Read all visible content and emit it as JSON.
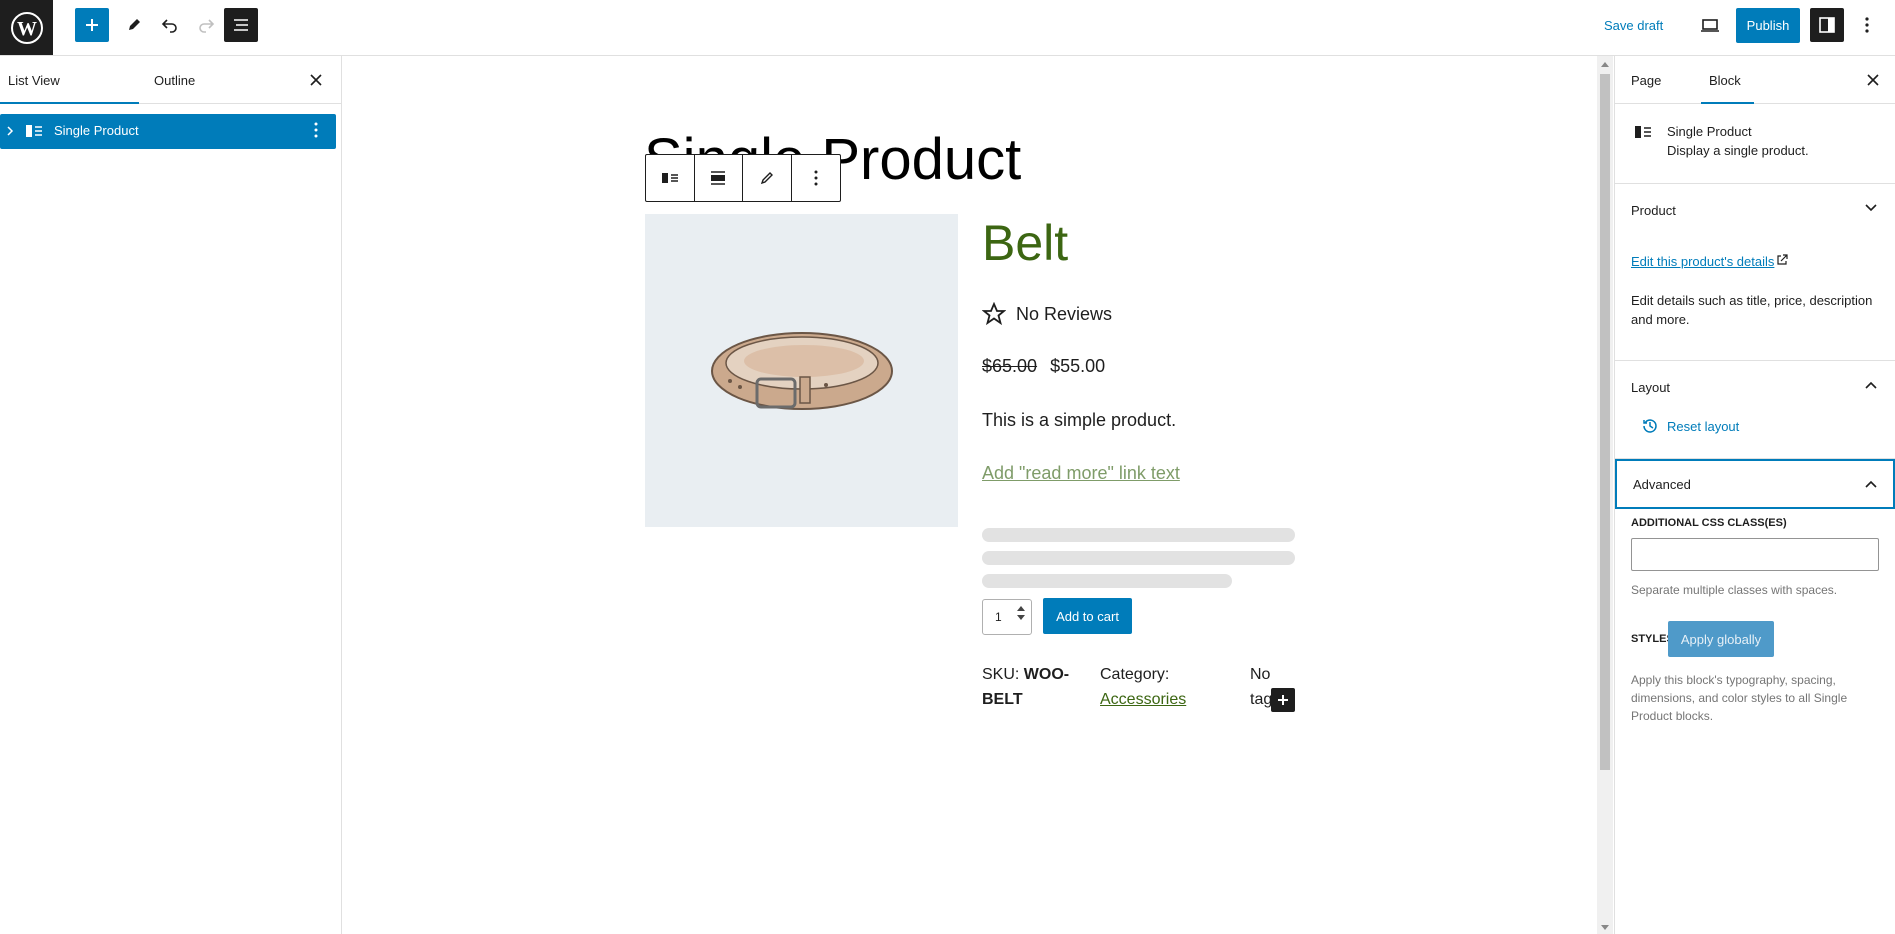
{
  "topbar": {
    "save_draft": "Save draft",
    "publish": "Publish"
  },
  "left_panel": {
    "tabs": [
      {
        "label": "List View"
      },
      {
        "label": "Outline"
      }
    ],
    "list_items": [
      {
        "label": "Single Product"
      }
    ]
  },
  "canvas": {
    "page_title": "Single Product",
    "product": {
      "name": "Belt",
      "reviews": "No Reviews",
      "price_old": "$65.00",
      "price_new": "$55.00",
      "description": "This is a simple product.",
      "read_more": "Add \"read more\" link text",
      "quantity": "1",
      "add_to_cart": "Add to cart",
      "sku_label": "SKU:",
      "sku_value": "WOO-BELT",
      "category_label": "Category:",
      "category_value": "Accessories",
      "tags_text": "No tag"
    }
  },
  "right_panel": {
    "tabs": [
      {
        "label": "Page"
      },
      {
        "label": "Block"
      }
    ],
    "block": {
      "title": "Single Product",
      "description": "Display a single product."
    },
    "product_section": {
      "title": "Product",
      "link": "Edit this product's details",
      "text": "Edit details such as title, price, description and more."
    },
    "layout_section": {
      "title": "Layout",
      "reset": "Reset layout"
    },
    "advanced_section": {
      "title": "Advanced",
      "css_label": "ADDITIONAL CSS CLASS(ES)",
      "css_value": "",
      "css_help": "Separate multiple classes with spaces.",
      "styles_label": "STYLES",
      "apply_globally": "Apply globally",
      "styles_help": "Apply this block's typography, spacing, dimensions, and color styles to all Single Product blocks."
    }
  },
  "colors": {
    "accent": "#007cba",
    "product_green": "#3c6612",
    "read_more_green": "#7f9c69"
  }
}
